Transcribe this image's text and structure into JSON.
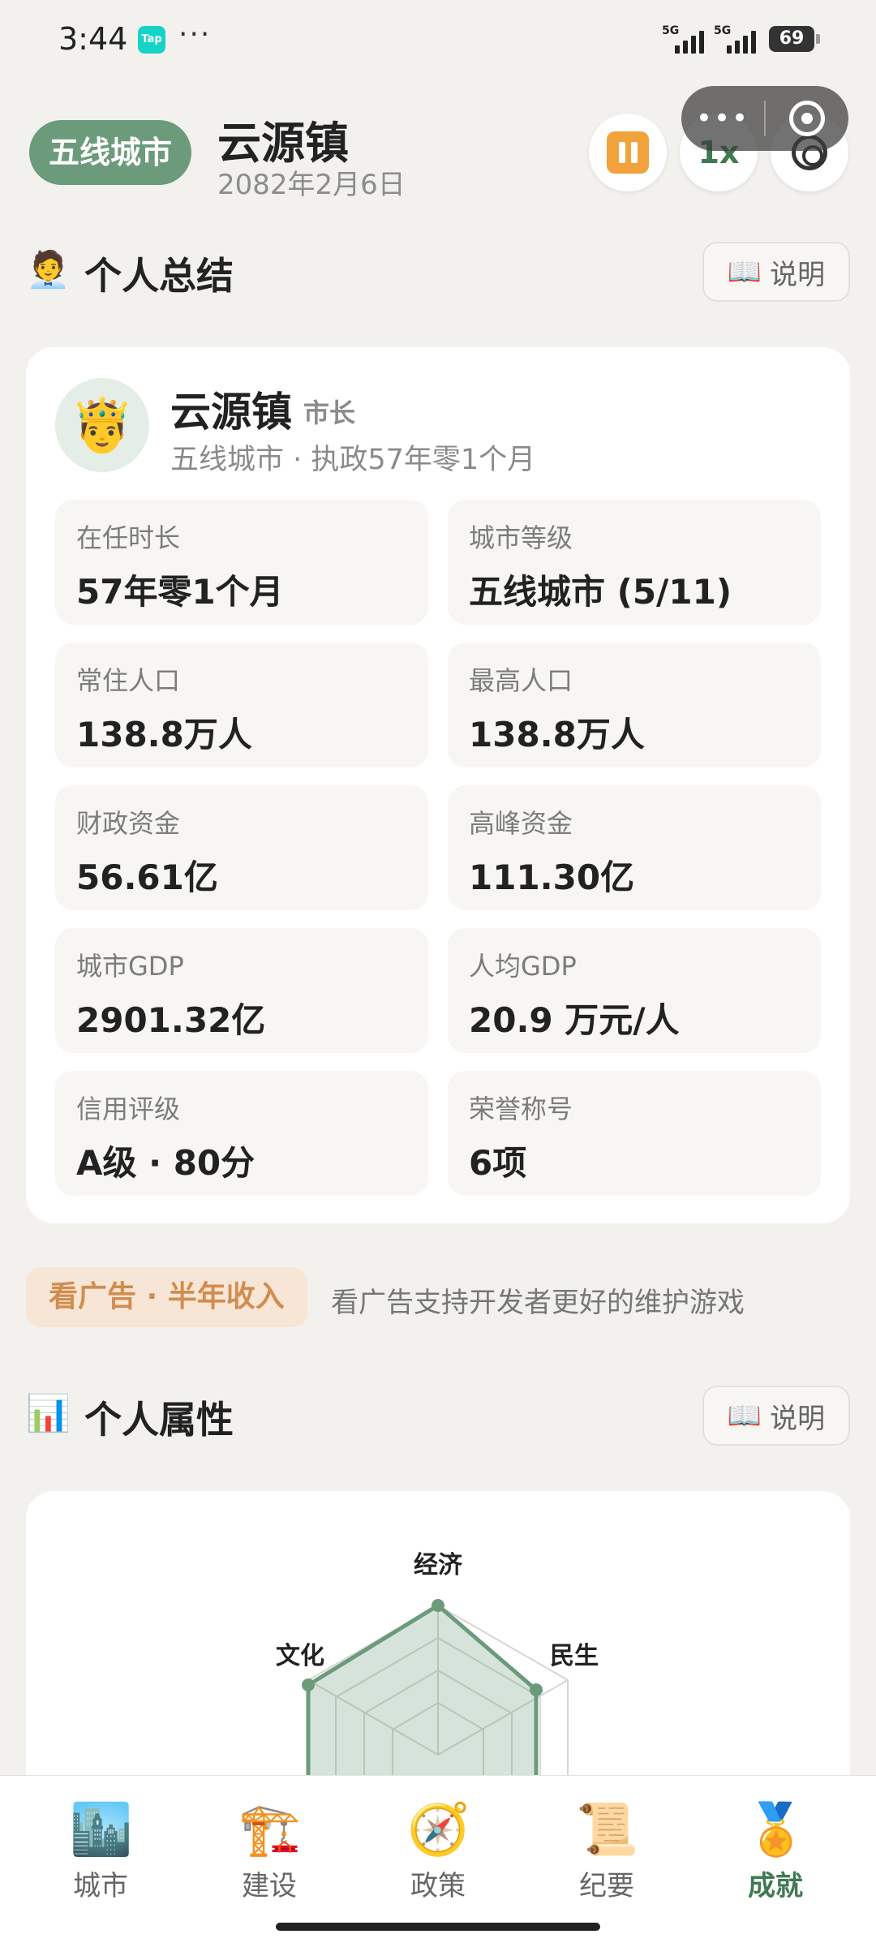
{
  "status_bar": {
    "time": "3:44",
    "app_badge": "Tap",
    "dots": "···",
    "signal1": "5G",
    "signal2": "5G",
    "battery": "69"
  },
  "header": {
    "city_tier": "五线城市",
    "city_name": "云源镇",
    "date": "2082年2月6日",
    "speed": "1x",
    "icons": [
      "pause-icon",
      "gear-icon",
      "more-icon",
      "target-icon"
    ],
    "capsule_more": "•••"
  },
  "personal_summary": {
    "emoji": "🧑‍💼",
    "title": "个人总结",
    "explain_icon": "📖",
    "explain_label": "说明",
    "avatar": "🤴",
    "mayor_name": "云源镇",
    "mayor_role": "市长",
    "subtitle": "五线城市 · 执政57年零1个月",
    "stats": [
      {
        "label": "在任时长",
        "value": "57年零1个月"
      },
      {
        "label": "城市等级",
        "value": "五线城市 (5/11)"
      },
      {
        "label": "常住人口",
        "value": "138.8万人"
      },
      {
        "label": "最高人口",
        "value": "138.8万人"
      },
      {
        "label": "财政资金",
        "value": "56.61亿"
      },
      {
        "label": "高峰资金",
        "value": "111.30亿"
      },
      {
        "label": "城市GDP",
        "value": "2901.32亿"
      },
      {
        "label": "人均GDP",
        "value": "20.9 万元/人"
      },
      {
        "label": "信用评级",
        "value": "A级 · 80分"
      },
      {
        "label": "荣誉称号",
        "value": "6项"
      }
    ]
  },
  "ad": {
    "button_label": "看广告 · 半年收入",
    "note": "看广告支持开发者更好的维护游戏"
  },
  "personal_attributes": {
    "emoji": "📊",
    "title": "个人属性",
    "explain_icon": "📖",
    "explain_label": "说明",
    "radar_labels": {
      "top": "经济",
      "right": "民生",
      "left": "文化"
    },
    "accent_color": "#6b9b7a"
  },
  "bottom_nav": [
    {
      "label": "城市",
      "icon": "🏙️",
      "active": false
    },
    {
      "label": "建设",
      "icon": "🏗️",
      "active": false
    },
    {
      "label": "政策",
      "icon": "🧭",
      "active": false
    },
    {
      "label": "纪要",
      "icon": "📜",
      "active": false
    },
    {
      "label": "成就",
      "icon": "🏅",
      "active": true
    }
  ]
}
